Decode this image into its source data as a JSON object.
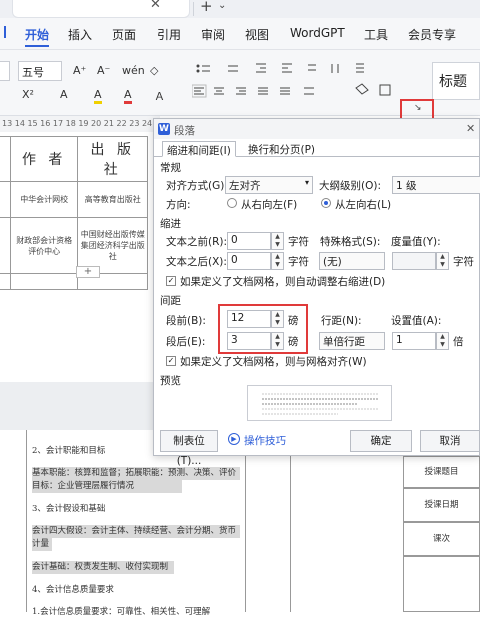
{
  "window": {
    "close_glyph": "✕",
    "new_tab_glyph": "+",
    "dropdown_glyph": "⌄"
  },
  "menu": {
    "items": [
      "开始",
      "插入",
      "页面",
      "引用",
      "审阅",
      "视图",
      "WordGPT",
      "工具",
      "会员专享"
    ],
    "active_index": 0
  },
  "ribbon": {
    "font_size": "五号",
    "style_sample": "标题",
    "glyphs": {
      "grow_font": "A⁺",
      "shrink_font": "A⁻",
      "phonetic": "wén",
      "clear_format": "◇",
      "superscript": "X²",
      "highlight": "A",
      "font_color": "A",
      "char_shade": "A"
    },
    "ruler_text": "13 14 15 16 17 18 19 20 21 22 23 24"
  },
  "doc": {
    "table_headers": [
      "作 者",
      "出 版 社"
    ],
    "table_rows": [
      [
        "中华会计网校",
        "高等教育出版社"
      ],
      [
        "财政部会计资格评价中心",
        "中国财经出版传媒集团经济科学出版社"
      ]
    ],
    "add_row_glyph": "+",
    "lines": [
      "2、会计职能和目标",
      "基本职能：核算和监督；拓展职能：预测、决策、评价",
      "目标：企业管理层履行情况",
      "3、会计假设和基础",
      "会计四大假设：会计主体、持续经营、会计分期、货币",
      "计量",
      "会计基础：权责发生制、收付实现制",
      "4、会计信息质量要求",
      "1.会计信息质量要求：可靠性、相关性、可理解"
    ],
    "right_cells": [
      "授课题目",
      "授课日期",
      "课次"
    ]
  },
  "dialog": {
    "title": "段落",
    "close_glyph": "✕",
    "tabs": [
      "缩进和间距(I)",
      "换行和分页(P)"
    ],
    "sections": {
      "general": "常规",
      "indent": "缩进",
      "spacing": "间距",
      "preview": "预览"
    },
    "alignment": {
      "label": "对齐方式(G):",
      "value": "左对齐"
    },
    "outline_level": {
      "label": "大纲级别(O):",
      "value": "1 级"
    },
    "direction": {
      "label": "方向:",
      "rtl": "从右向左(F)",
      "ltr": "从左向右(L)",
      "selected": "ltr"
    },
    "indent_before": {
      "label": "文本之前(R):",
      "value": "0",
      "unit": "字符"
    },
    "indent_after": {
      "label": "文本之后(X):",
      "value": "0",
      "unit": "字符"
    },
    "special": {
      "label": "特殊格式(S):",
      "value": "(无)"
    },
    "measure": {
      "label": "度量值(Y):",
      "value": "",
      "unit": "字符"
    },
    "grid_indent": {
      "label": "如果定义了文档网格，则自动调整右缩进(D)",
      "checked": true
    },
    "space_before": {
      "label": "段前(B):",
      "value": "12",
      "unit": "磅"
    },
    "space_after": {
      "label": "段后(E):",
      "value": "3",
      "unit": "磅"
    },
    "line_spacing": {
      "label": "行距(N):",
      "value": "单倍行距"
    },
    "set_value": {
      "label": "设置值(A):",
      "value": "1",
      "unit": "倍"
    },
    "grid_align": {
      "label": "如果定义了文档网格，则与网格对齐(W)",
      "checked": true
    },
    "buttons": {
      "tabs": "制表位(T)...",
      "tips": "操作技巧",
      "ok": "确定",
      "cancel": "取消"
    },
    "colors": {
      "accent": "#2f5fd8",
      "highlight_box": "#e03a3a"
    }
  }
}
